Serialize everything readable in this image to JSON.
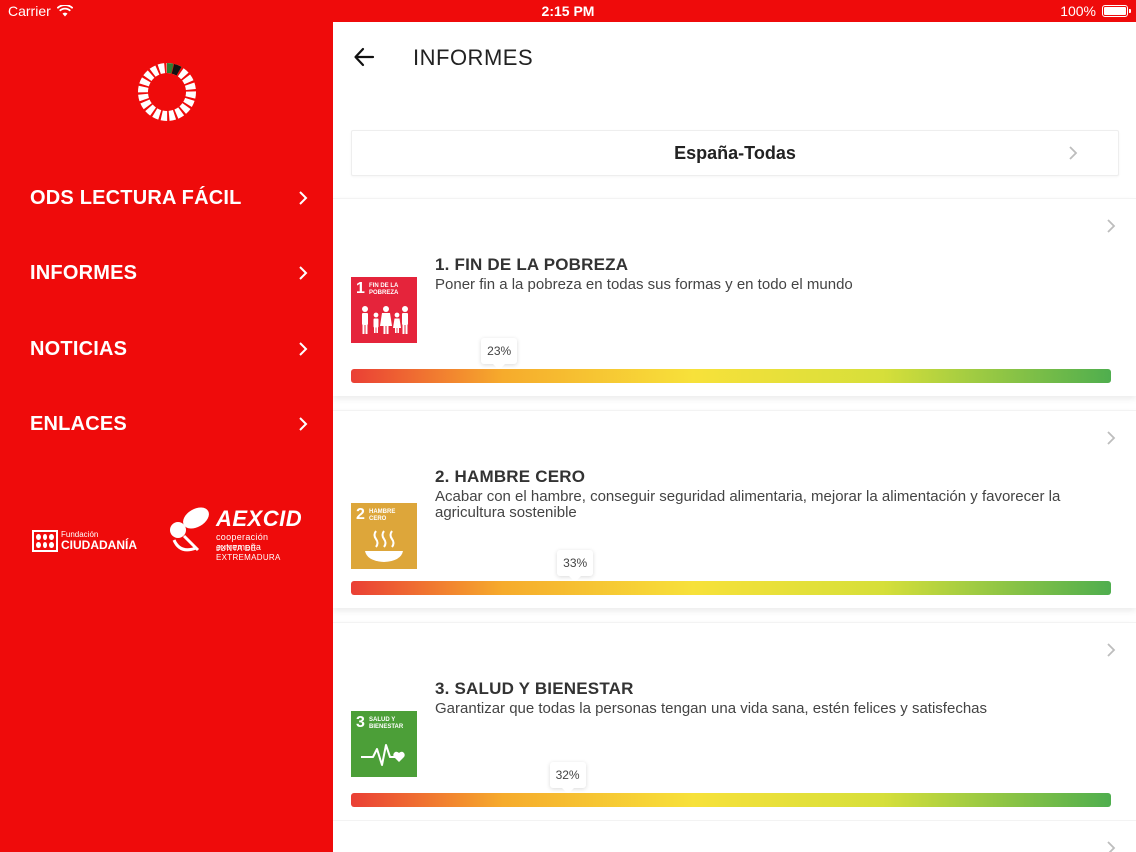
{
  "status_bar": {
    "carrier": "Carrier",
    "time": "2:15 PM",
    "battery": "100%"
  },
  "sidebar": {
    "items": [
      {
        "label": "ODS LECTURA FÁCIL"
      },
      {
        "label": "INFORMES"
      },
      {
        "label": "NOTICIAS"
      },
      {
        "label": "ENLACES"
      }
    ],
    "partners": {
      "fundacion_small": "Fundación",
      "fundacion_big": "CIUDADANÍA",
      "aexcid_name": "AEXCID",
      "aexcid_sub1": "cooperación extremeña",
      "aexcid_sub2": "JUNTA DE EXTREMADURA"
    }
  },
  "header": {
    "title": "INFORMES"
  },
  "selector": {
    "label": "España-Todas"
  },
  "goals": [
    {
      "title": "1. FIN DE LA POBREZA",
      "description": "Poner fin a la pobreza en todas sus formas y en todo el mundo",
      "progress_label": "23%",
      "progress": 0.195,
      "icon_number": "1",
      "icon_caption": "FIN DE LA POBREZA",
      "icon_color": "#e5243b",
      "icon": "family-icon"
    },
    {
      "title": "2. HAMBRE CERO",
      "description": "Acabar con el hambre, conseguir seguridad alimentaria, mejorar la alimentación y favorecer la agricultura sostenible",
      "progress_label": "33%",
      "progress": 0.295,
      "icon_number": "2",
      "icon_caption": "HAMBRE CERO",
      "icon_color": "#dda63a",
      "icon": "bowl-icon"
    },
    {
      "title": "3. SALUD Y BIENESTAR",
      "description": "Garantizar que todas la personas tengan una vida sana, estén felices y satisfechas",
      "progress_label": "32%",
      "progress": 0.285,
      "icon_number": "3",
      "icon_caption": "SALUD Y BIENESTAR",
      "icon_color": "#4c9f38",
      "icon": "heartbeat-icon"
    }
  ],
  "colors": {
    "brand_red": "#ef0b0b"
  }
}
